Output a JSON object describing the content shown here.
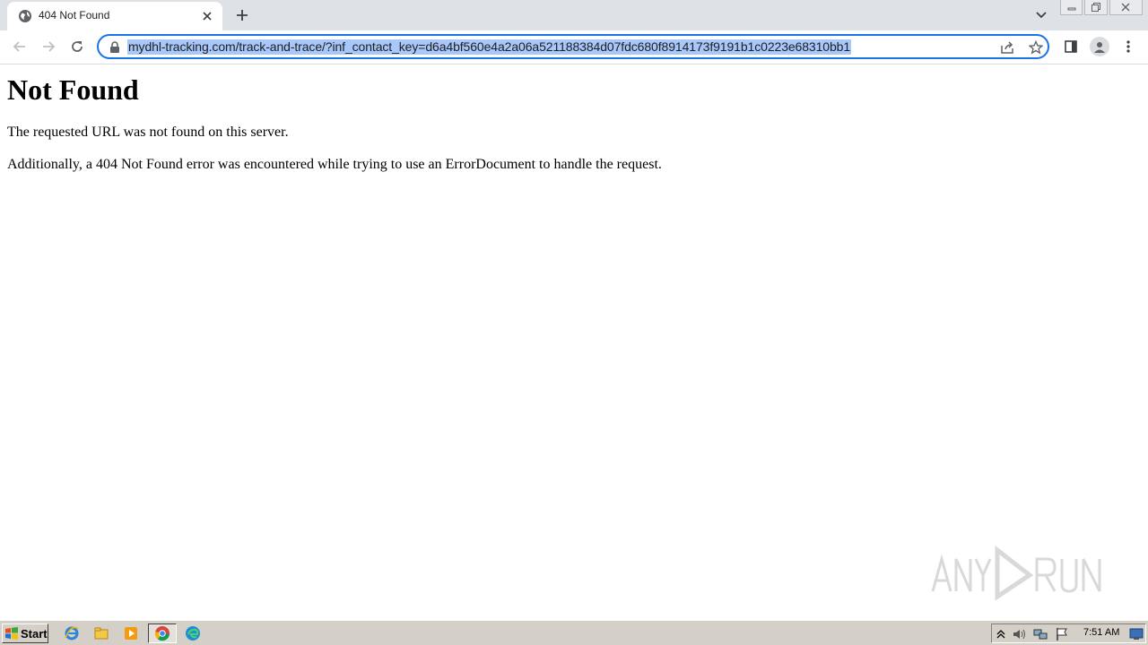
{
  "tab": {
    "title": "404 Not Found"
  },
  "omnibox": {
    "url": "mydhl-tracking.com/track-and-trace/?inf_contact_key=d6a4bf560e4a2a06a521188384d07fdc680f8914173f9191b1c0223e68310bb1"
  },
  "page": {
    "heading": "Not Found",
    "paragraph1": "The requested URL was not found on this server.",
    "paragraph2": "Additionally, a 404 Not Found error was encountered while trying to use an ErrorDocument to handle the request."
  },
  "watermark": {
    "text": "ANY RUN"
  },
  "taskbar": {
    "start_label": "Start",
    "apps": [
      "internet-explorer-icon",
      "file-explorer-icon",
      "media-player-icon",
      "chrome-icon",
      "edge-icon"
    ],
    "clock": "7:51 AM"
  },
  "colors": {
    "accent": "#1a73e8",
    "selection": "#a8c7fa",
    "tabstrip": "#dee1e6",
    "taskbar": "#d4d0c8"
  }
}
